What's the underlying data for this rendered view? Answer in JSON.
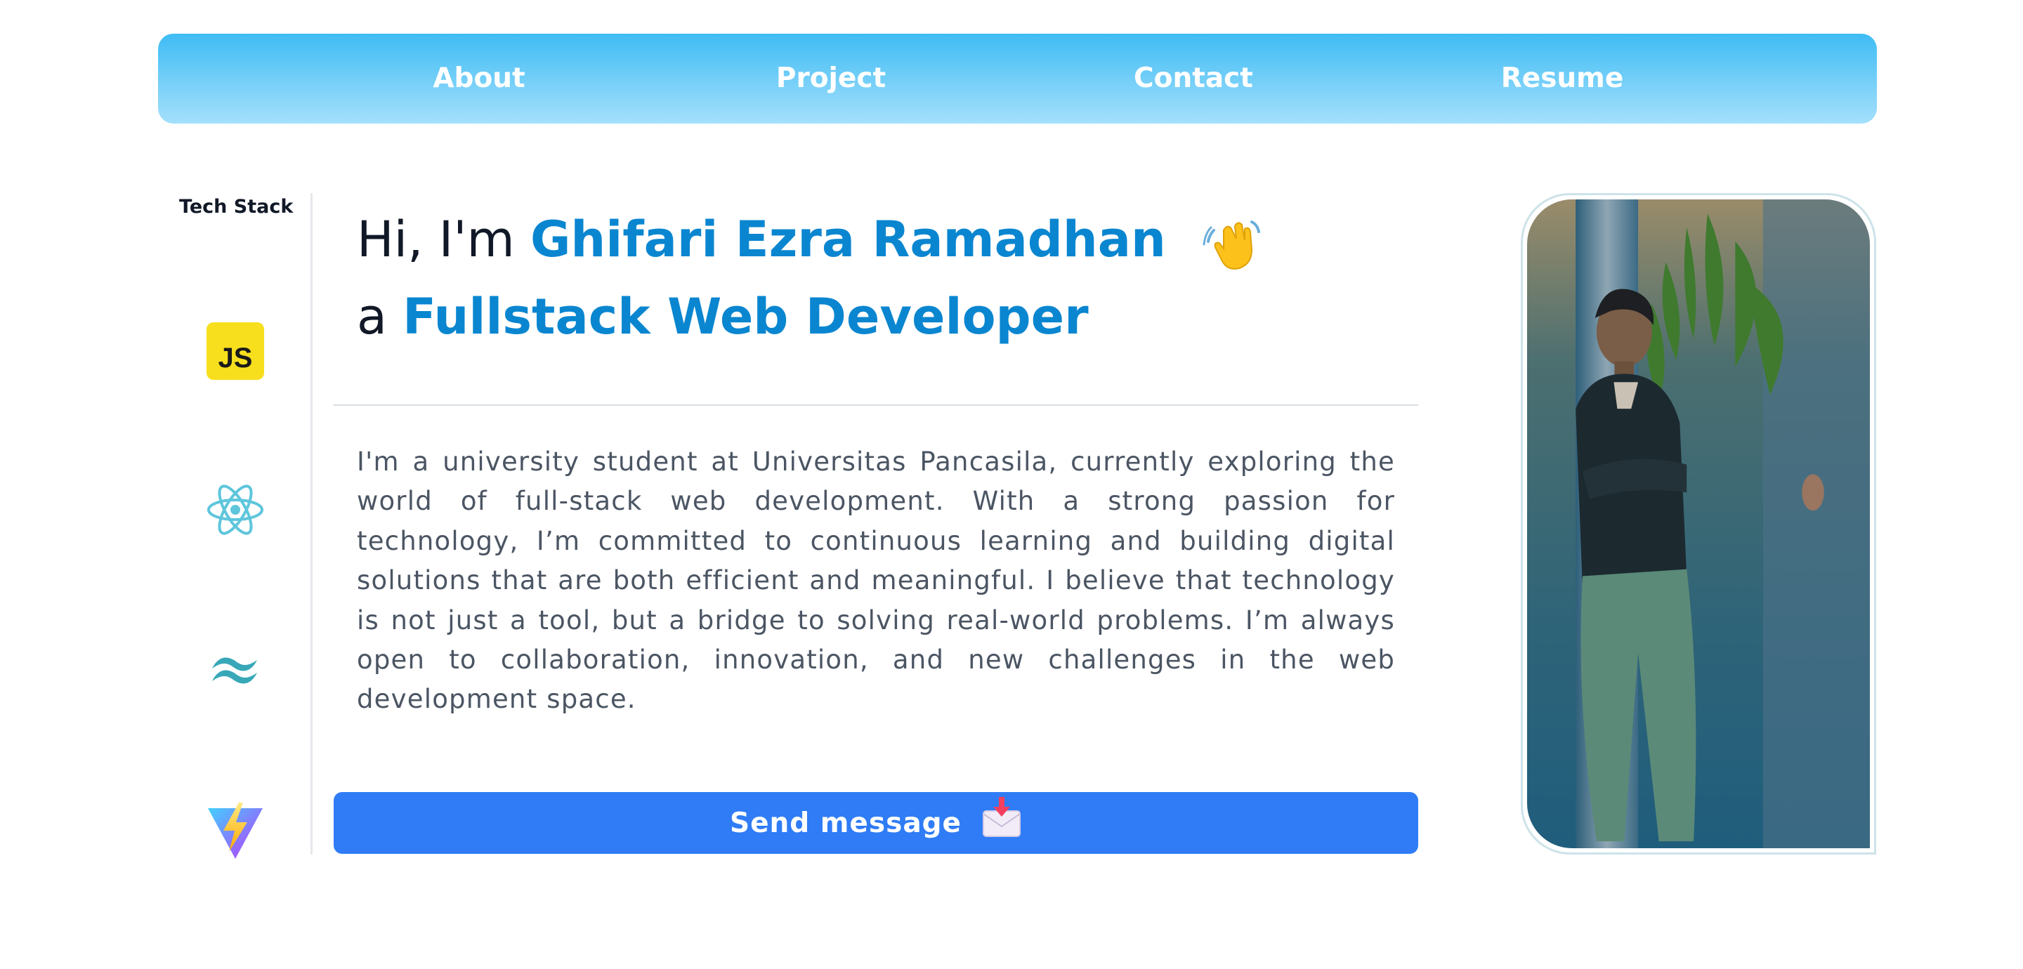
{
  "nav": {
    "items": [
      {
        "label": "About"
      },
      {
        "label": "Project"
      },
      {
        "label": "Contact"
      },
      {
        "label": "Resume"
      }
    ]
  },
  "sidebar": {
    "title": "Tech Stack",
    "icons": [
      "javascript-icon",
      "react-icon",
      "tailwind-icon",
      "vite-icon"
    ],
    "js_label": "JS"
  },
  "hero": {
    "greeting_prefix": "Hi, I'm",
    "name": "Ghifari Ezra Ramadhan",
    "greeting_emoji": "waving-hand-icon",
    "role_prefix": "a",
    "role": "Fullstack Web Developer"
  },
  "bio": "I'm a university student at Universitas Pancasila, currently exploring the world of full-stack web development. With a strong passion for technology, I’m committed to continuous learning and building digital solutions that are both efficient and meaningful. I believe that technology is not just a tool, but a bridge to solving real-world problems. I’m always open to collaboration, innovation, and new challenges in the web development space.",
  "cta": {
    "label": "Send message",
    "icon": "envelope-icon"
  },
  "colors": {
    "nav_gradient_top": "#3fbcf4",
    "nav_gradient_bottom": "#a5e0fc",
    "accent": "#0a86d0",
    "button": "#2f7cf6"
  }
}
